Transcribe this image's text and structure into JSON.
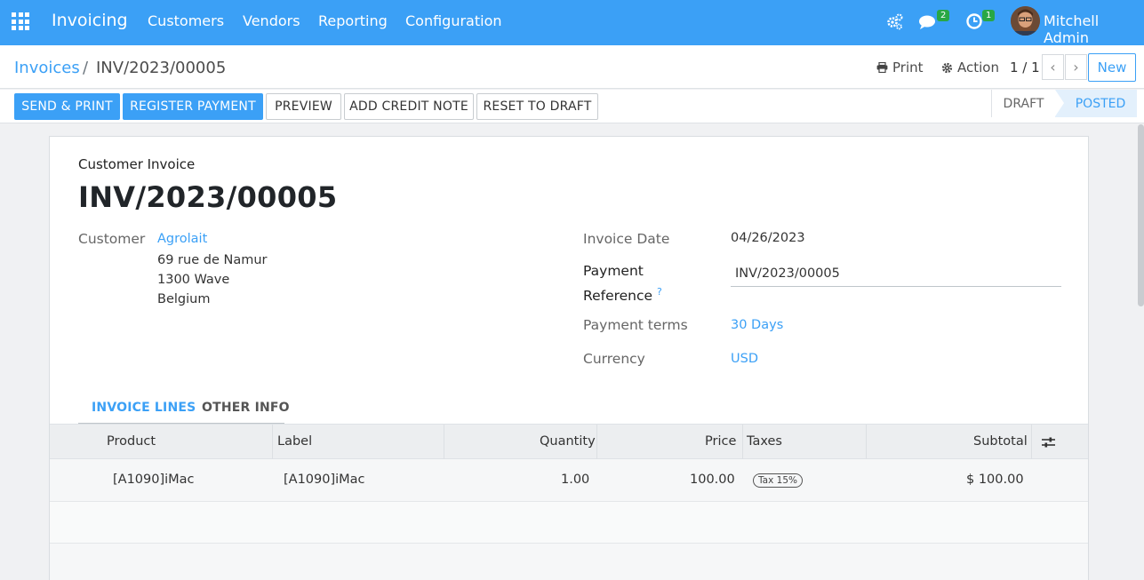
{
  "navbar": {
    "brand": "Invoicing",
    "menu": [
      "Customers",
      "Vendors",
      "Reporting",
      "Configuration"
    ],
    "messages_count": "2",
    "activities_count": "1",
    "user_name": "Mitchell Admin"
  },
  "control": {
    "breadcrumb_parent": "Invoices",
    "breadcrumb_sep": "/",
    "breadcrumb_current": "INV/2023/00005",
    "print_label": "Print",
    "action_label": "Action",
    "pager": "1 / 1",
    "new_label": "New"
  },
  "statusbar": {
    "buttons": [
      "SEND & PRINT",
      "REGISTER PAYMENT",
      "PREVIEW",
      "ADD CREDIT NOTE",
      "RESET TO DRAFT"
    ],
    "stages": [
      "DRAFT",
      "POSTED"
    ]
  },
  "sheet": {
    "doc_type": "Customer Invoice",
    "doc_name": "INV/2023/00005",
    "customer_label": "Customer",
    "customer_name": "Agrolait",
    "address": [
      "69 rue de Namur",
      "1300 Wave",
      "Belgium"
    ],
    "invoice_date_label": "Invoice Date",
    "invoice_date": "04/26/2023",
    "payment_ref_label_1": "Payment",
    "payment_ref_label_2": "Reference",
    "payment_ref_help": "?",
    "payment_ref_value": "INV/2023/00005",
    "payment_terms_label": "Payment terms",
    "payment_terms": "30 Days",
    "currency_label": "Currency",
    "currency": "USD"
  },
  "tabs": [
    "INVOICE LINES",
    "OTHER INFO"
  ],
  "table": {
    "headers": [
      "Product",
      "Label",
      "Quantity",
      "Price",
      "Taxes",
      "Subtotal"
    ],
    "rows": [
      {
        "product": "[A1090]iMac",
        "label": "[A1090]iMac",
        "quantity": "1.00",
        "price": "100.00",
        "tax": "Tax 15%",
        "subtotal": "$ 100.00"
      }
    ]
  },
  "colors": {
    "primary": "#3ba0f6",
    "badge": "#28a745"
  }
}
